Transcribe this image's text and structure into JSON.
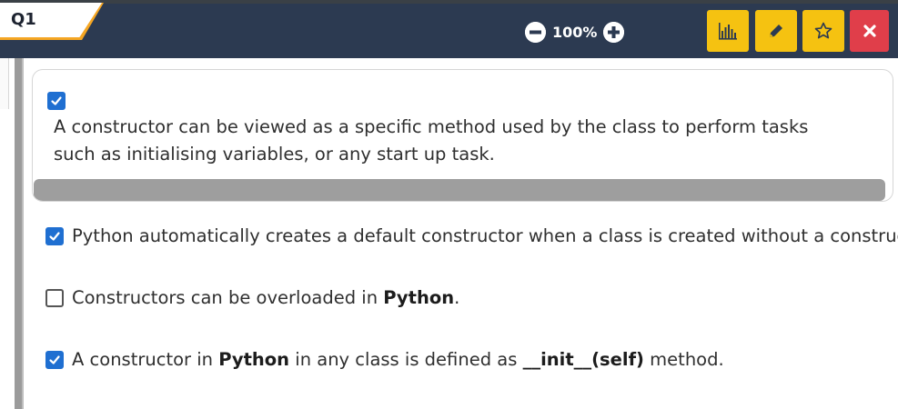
{
  "header": {
    "tab_label": "Q1",
    "zoom_value": "100%",
    "zoom_out_icon": "minus-circle-icon",
    "zoom_in_icon": "plus-circle-icon",
    "toolbar": [
      {
        "icon": "bar-chart-icon",
        "color": "#f5c211"
      },
      {
        "icon": "pencil-icon",
        "color": "#f5c211"
      },
      {
        "icon": "star-outline-icon",
        "color": "#f5c211"
      },
      {
        "icon": "close-icon",
        "color": "#e03e4a"
      }
    ],
    "bar_color": "#2c3a51",
    "tab_accent": "#f5a623"
  },
  "options": [
    {
      "checked": true,
      "text": "A constructor can be viewed as a specific method used by the class to perform tasks such as initialising variables, or any start up task."
    },
    {
      "checked": true,
      "text": "Python automatically creates a default constructor when a class is created without a constructor"
    },
    {
      "checked": false,
      "text_before": "Constructors can be overloaded in ",
      "bold": "Python",
      "text_after": "."
    },
    {
      "checked": true,
      "text_before": "A constructor in ",
      "bold": "Python",
      "text_mid": " in any class is defined as ",
      "bold2": "__init__(self)",
      "text_after": " method."
    }
  ],
  "checkbox_color": "#1f6fd1"
}
